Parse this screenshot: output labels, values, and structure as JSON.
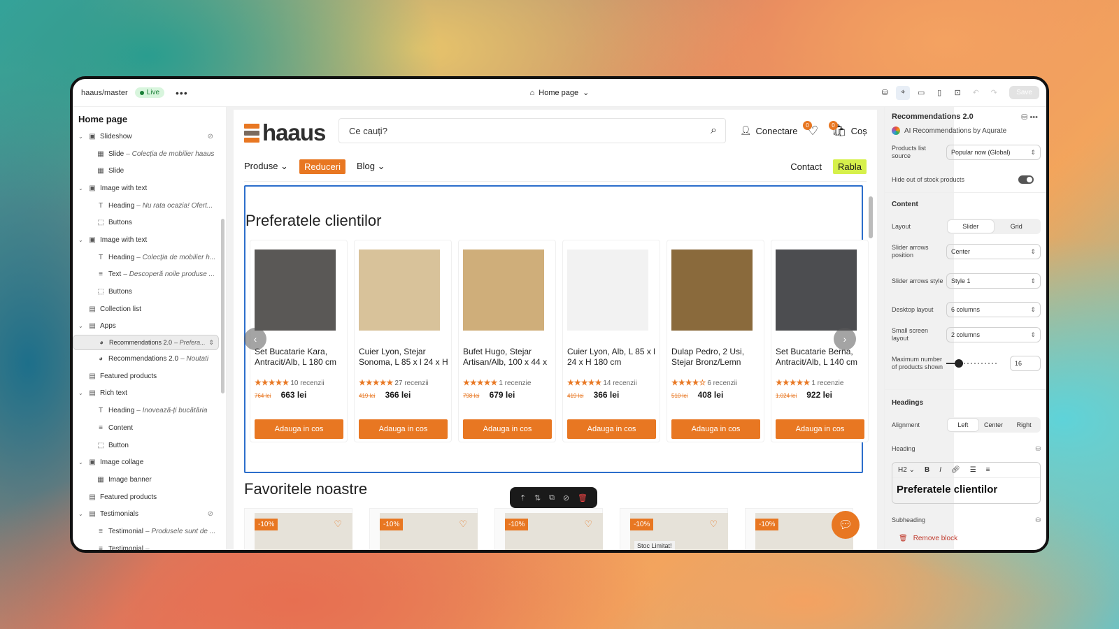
{
  "topbar": {
    "repo": "haaus/master",
    "live": "Live",
    "more": "•••",
    "page": "Home page",
    "save": "Save"
  },
  "left": {
    "title": "Home page",
    "items": [
      {
        "label": "Slideshow",
        "sub": "",
        "depth": 0,
        "chev": "⌄",
        "icon": "▣",
        "hidden": true
      },
      {
        "label": "Slide",
        "sub": "Colecția de mobilier haaus",
        "depth": 1,
        "chev": "",
        "icon": "▦"
      },
      {
        "label": "Slide",
        "sub": "",
        "depth": 1,
        "chev": "",
        "icon": "▦"
      },
      {
        "label": "Image with text",
        "sub": "",
        "depth": 0,
        "chev": "⌄",
        "icon": "▣"
      },
      {
        "label": "Heading",
        "sub": "Nu rata ocazia! Ofert...",
        "depth": 1,
        "chev": "",
        "icon": "T"
      },
      {
        "label": "Buttons",
        "sub": "",
        "depth": 1,
        "chev": "",
        "icon": "⬚"
      },
      {
        "label": "Image with text",
        "sub": "",
        "depth": 0,
        "chev": "⌄",
        "icon": "▣"
      },
      {
        "label": "Heading",
        "sub": "Colecția de mobilier h...",
        "depth": 1,
        "chev": "",
        "icon": "T"
      },
      {
        "label": "Text",
        "sub": "Descoperă noile produse ...",
        "depth": 1,
        "chev": "",
        "icon": "≡"
      },
      {
        "label": "Buttons",
        "sub": "",
        "depth": 1,
        "chev": "",
        "icon": "⬚"
      },
      {
        "label": "Collection list",
        "sub": "",
        "depth": 0,
        "chev": "",
        "icon": "▤"
      },
      {
        "label": "Apps",
        "sub": "",
        "depth": 0,
        "chev": "⌄",
        "icon": "▤"
      },
      {
        "label": "Recommendations 2.0",
        "sub": "Prefera...",
        "depth": 1,
        "chev": "",
        "icon": "◕",
        "sel": true
      },
      {
        "label": "Recommendations 2.0",
        "sub": "Noutati",
        "depth": 1,
        "chev": "",
        "icon": "◕"
      },
      {
        "label": "Featured products",
        "sub": "",
        "depth": 0,
        "chev": "",
        "icon": "▤"
      },
      {
        "label": "Rich text",
        "sub": "",
        "depth": 0,
        "chev": "⌄",
        "icon": "▤"
      },
      {
        "label": "Heading",
        "sub": "Inovează-ți bucătăria",
        "depth": 1,
        "chev": "",
        "icon": "T"
      },
      {
        "label": "Content",
        "sub": "",
        "depth": 1,
        "chev": "",
        "icon": "≡"
      },
      {
        "label": "Button",
        "sub": "",
        "depth": 1,
        "chev": "",
        "icon": "⬚"
      },
      {
        "label": "Image collage",
        "sub": "",
        "depth": 0,
        "chev": "⌄",
        "icon": "▣"
      },
      {
        "label": "Image banner",
        "sub": "",
        "depth": 1,
        "chev": "",
        "icon": "▦"
      },
      {
        "label": "Featured products",
        "sub": "",
        "depth": 0,
        "chev": "",
        "icon": "▤"
      },
      {
        "label": "Testimonials",
        "sub": "",
        "depth": 0,
        "chev": "⌄",
        "icon": "▤",
        "hidden": true
      },
      {
        "label": "Testimonial",
        "sub": "Produsele sunt de ...",
        "depth": 1,
        "chev": "",
        "icon": "≡"
      },
      {
        "label": "Testimonial",
        "sub": "...",
        "depth": 1,
        "chev": "",
        "icon": "≡"
      }
    ]
  },
  "store": {
    "logo": "haaus",
    "search_placeholder": "Ce cauți?",
    "account": "Conectare",
    "wishlist_count": "0",
    "cart": "Coș",
    "cart_count": "0",
    "nav": {
      "produse": "Produse",
      "reduceri": "Reduceri",
      "blog": "Blog",
      "contact": "Contact",
      "rabla": "Rabla"
    },
    "section_title": "Preferatele clientilor",
    "add_label": "Adauga in cos",
    "products": [
      {
        "name": "Set Bucatarie Kara, Antracit/Alb, L 180 cm",
        "stars": "★★★★★",
        "reviews": "10 recenzii",
        "old": "764 lei",
        "price": "663 lei",
        "color": "#5a5856"
      },
      {
        "name": "Cuier Lyon, Stejar Sonoma, L 85 x l 24 x H",
        "stars": "★★★★★",
        "reviews": "27 recenzii",
        "old": "419 lei",
        "price": "366 lei",
        "color": "#d8c29a"
      },
      {
        "name": "Bufet Hugo, Stejar Artisan/Alb, 100 x 44 x",
        "stars": "★★★★★",
        "reviews": "1 recenzie",
        "old": "798 lei",
        "price": "679 lei",
        "color": "#cfae7a"
      },
      {
        "name": "Cuier Lyon, Alb, L 85 x l 24 x H 180 cm",
        "stars": "★★★★★",
        "reviews": "14 recenzii",
        "old": "419 lei",
        "price": "366 lei",
        "color": "#f2f2f2"
      },
      {
        "name": "Dulap Pedro, 2 Usi, Stejar Bronz/Lemn",
        "stars": "★★★★☆",
        "reviews": "6 recenzii",
        "old": "510 lei",
        "price": "408 lei",
        "color": "#8a6a3c"
      },
      {
        "name": "Set Bucatarie Berna, Antracit/Alb, L 140 cm",
        "stars": "★★★★★",
        "reviews": "1 recenzie",
        "old": "1.024 lei",
        "price": "922 lei",
        "color": "#4c4d50"
      }
    ],
    "favorites_title": "Favoritele noastre",
    "tiles": [
      {
        "disc": "-10%"
      },
      {
        "disc": "-10%"
      },
      {
        "disc": "-10%"
      },
      {
        "disc": "-10%",
        "stoc": "Stoc Limitat!"
      },
      {
        "disc": "-10%"
      }
    ]
  },
  "right": {
    "title": "Recommendations 2.0",
    "app": "AI Recommendations by Aqurate",
    "source_label": "Products list source",
    "source": "Popular now (Global)",
    "hide_label": "Hide out of stock products",
    "content": "Content",
    "layout_label": "Layout",
    "layout_opts": [
      "Slider",
      "Grid"
    ],
    "arrows_pos_label": "Slider arrows position",
    "arrows_pos": "Center",
    "arrows_style_label": "Slider arrows style",
    "arrows_style": "Style 1",
    "desktop_label": "Desktop layout",
    "desktop": "6 columns",
    "small_label": "Small screen layout",
    "small": "2 columns",
    "max_label": "Maximum number of products shown",
    "max": "16",
    "headings": "Headings",
    "align_label": "Alignment",
    "align_opts": [
      "Left",
      "Center",
      "Right"
    ],
    "heading_label": "Heading",
    "heading_level": "H2",
    "heading_text": "Preferatele clientilor",
    "subheading_label": "Subheading",
    "remove": "Remove block"
  },
  "colors": {
    "accent": "#e87722",
    "selection": "#2c6ecb",
    "rabla": "#d6f04b"
  }
}
